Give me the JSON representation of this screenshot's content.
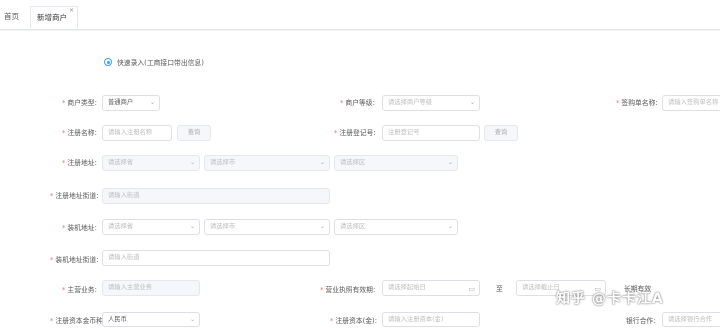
{
  "tabs": [
    {
      "label": "首页"
    },
    {
      "label": "新增商户"
    }
  ],
  "radio": {
    "label": "快速录入(工商接口带出信息)"
  },
  "fields": {
    "merchant_type": {
      "label": "商户类型:",
      "value": "普通商户"
    },
    "merchant_level": {
      "label": "商户等级:",
      "placeholder": "请选择商户等级"
    },
    "sign_name": {
      "label": "签购单名称:",
      "placeholder": "请输入签购单名称"
    },
    "reg_name": {
      "label": "注册名称:",
      "placeholder": "请输入注册名称",
      "button": "查询"
    },
    "reg_no": {
      "label": "注册登记号:",
      "placeholder": "注册登记号",
      "button": "查询"
    },
    "reg_addr": {
      "label": "注册地址:",
      "province": "请选择省",
      "city": "请选择市",
      "district": "请选择区"
    },
    "reg_street": {
      "label": "注册地址街道:",
      "placeholder": "请输入街道"
    },
    "install_addr": {
      "label": "装机地址:",
      "province": "请选择省",
      "city": "请选择市",
      "district": "请选择区"
    },
    "install_street": {
      "label": "装机地址街道:",
      "placeholder": "请输入街道"
    },
    "main_business": {
      "label": "主营业务:",
      "placeholder": "请输入主营业务"
    },
    "license_valid": {
      "label": "营业执照有效期:",
      "start": "请选择起始日",
      "sep": "至",
      "end": "请选择截止日",
      "longterm": "长期有效"
    },
    "currency": {
      "label": "注册资本金币种:",
      "value": "人民币"
    },
    "capital": {
      "label": "注册资本(金):",
      "placeholder": "请输入注册资本(金)"
    },
    "bank": {
      "label": "银行合作:",
      "placeholder": "请选择银行合作"
    }
  },
  "watermark": "知乎 @卡卡江A"
}
